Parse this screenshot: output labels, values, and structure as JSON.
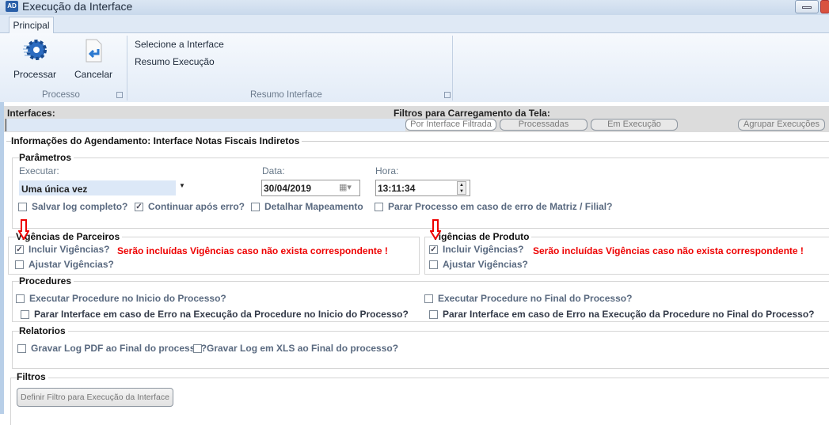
{
  "window": {
    "title": "Execução da Interface",
    "icon_text": "AD"
  },
  "ribbon": {
    "tab": "Principal",
    "buttons": {
      "processar": "Processar",
      "cancelar": "Cancelar"
    },
    "group_processo": "Processo",
    "links": [
      "Selecione a Interface",
      "Resumo Execução"
    ],
    "group_resumo": "Resumo Interface"
  },
  "strip": {
    "interfaces_label": "Interfaces:",
    "filters_label": "Filtros para Carregamento da Tela:",
    "filters": [
      "Por Interface Filtrada",
      "Processadas",
      "Em Execução"
    ],
    "group_button": "Agrupar Execuções"
  },
  "info_title": "Informações do Agendamento: Interface Notas Fiscais Indiretos",
  "parametros": {
    "title": "Parâmetros",
    "executar_label": "Executar:",
    "executar_value": "Uma única vez",
    "data_label": "Data:",
    "data_value": "30/04/2019",
    "hora_label": "Hora:",
    "hora_value": "13:11:34",
    "checks": [
      {
        "label": "Salvar log completo?",
        "checked": false
      },
      {
        "label": "Continuar após erro?",
        "checked": true
      },
      {
        "label": "Detalhar Mapeamento",
        "checked": false
      },
      {
        "label": "Parar Processo em caso de erro de Matriz / Filial?",
        "checked": false
      }
    ]
  },
  "vig_parceiros": {
    "title": "Vigências  de Parceiros",
    "incluir": "Incluir Vigências?",
    "ajustar": "Ajustar Vigências?",
    "warning": "Serão incluídas Vigências caso não exista correspondente !"
  },
  "vig_produto": {
    "title": "Vigências  de Produto",
    "incluir": "Incluir Vigências?",
    "ajustar": "Ajustar Vigências?",
    "warning": "Serão incluídas Vigências caso não exista correspondente !"
  },
  "procedures": {
    "title": "Procedures",
    "exec_inicio": "Executar Procedure no Inicio do Processo?",
    "parar_inicio": "Parar Interface em caso de Erro na Execução da Procedure no Inicio do Processo?",
    "exec_final": "Executar Procedure no Final do Processo?",
    "parar_final": "Parar Interface em caso de Erro na Execução da Procedure no Final do Processo?"
  },
  "relatorios": {
    "title": "Relatorios",
    "pdf": "Gravar Log PDF ao Final do processo?",
    "xls": "Gravar Log em XLS ao Final do processo?"
  },
  "filtros": {
    "title": "Filtros",
    "button": "Definir Filtro para Execução da Interface"
  },
  "colors": {
    "accent": "#2a5fa8",
    "warning": "#ee0000"
  }
}
